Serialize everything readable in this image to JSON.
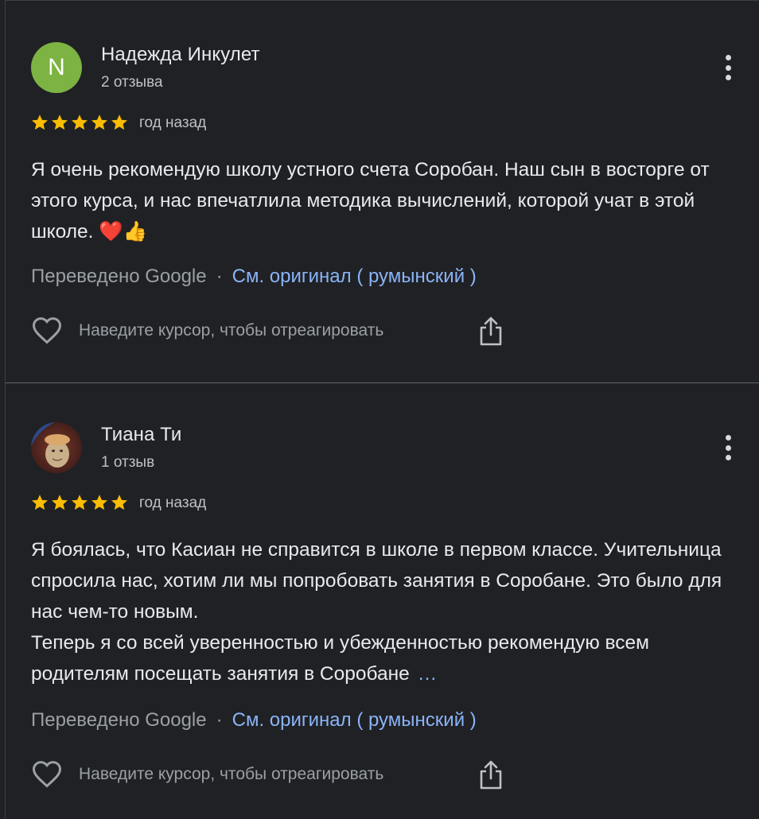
{
  "reviews": [
    {
      "avatar_letter": "N",
      "avatar_color": "#7cb342",
      "name": "Надежда Инкулет",
      "count": "2 отзыва",
      "rating": 5,
      "when": "год назад",
      "text_lines": [
        "Я очень рекомендую школу устного счета Соробан. Наш сын в восторге от этого курса, и нас впечатлила методика вычислений, которой учат в этой школе. ❤️👍"
      ],
      "translated_label": "Переведено Google",
      "separator": "·",
      "original_link": "См. оригинал ( румынский )",
      "react_label": "Наведите курсор, чтобы отреагировать"
    },
    {
      "avatar_letter": "",
      "name": "Тиана Ти",
      "count": "1 отзыв",
      "rating": 5,
      "when": "год назад",
      "text_lines": [
        "Я боялась, что Касиан не справится в школе в первом классе. Учительница спросила нас, хотим ли мы попробовать занятия в Соробане. Это было для нас чем-то новым.",
        "Теперь я со всей уверенностью и убежденностью рекомендую всем родителям посещать занятия в Соробане"
      ],
      "more_label": "…",
      "translated_label": "Переведено Google",
      "separator": "·",
      "original_link": "См. оригинал ( румынский )",
      "react_label": "Наведите курсор, чтобы отреагировать"
    }
  ],
  "colors": {
    "background": "#202124",
    "star": "#fbbc04",
    "link": "#8ab4f8",
    "muted": "#9aa0a6"
  }
}
